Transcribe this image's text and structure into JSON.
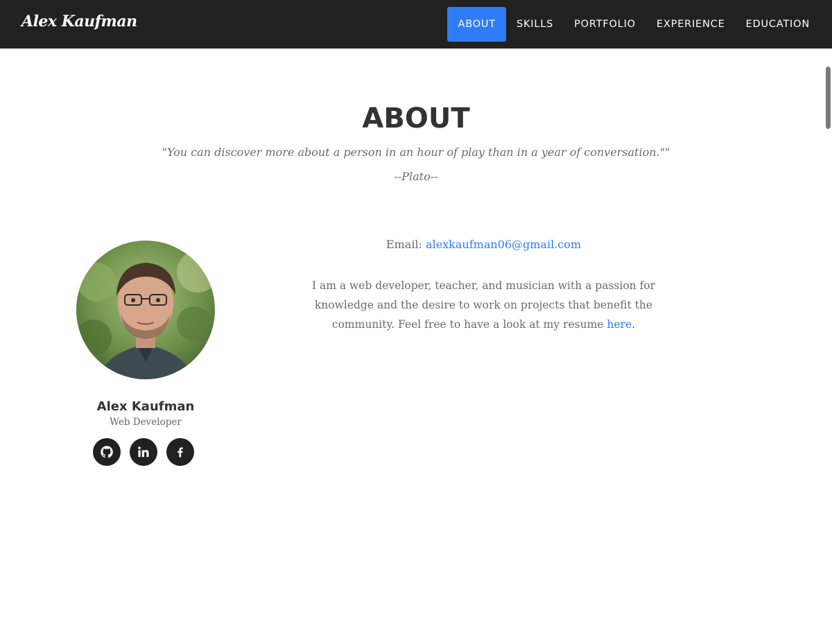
{
  "navbar": {
    "brand": "Alex Kaufman",
    "items": [
      {
        "label": "ABOUT",
        "active": true
      },
      {
        "label": "SKILLS",
        "active": false
      },
      {
        "label": "PORTFOLIO",
        "active": false
      },
      {
        "label": "EXPERIENCE",
        "active": false
      },
      {
        "label": "EDUCATION",
        "active": false
      }
    ]
  },
  "about": {
    "title": "ABOUT",
    "quote": "\"You can discover more about a person in an hour of play than in a year of conversation.\"\"",
    "quote_author": "--Plato--"
  },
  "profile": {
    "name": "Alex Kaufman",
    "role": "Web Developer",
    "socials": [
      "github-icon",
      "linkedin-icon",
      "facebook-icon"
    ]
  },
  "contact": {
    "email_label": "Email:",
    "email": "alexkaufman06@gmail.com"
  },
  "bio": {
    "text": "I am a web developer, teacher, and musician with a passion for knowledge and the desire to work on projects that benefit the community. Feel free to have a look at my resume",
    "link_text": "here",
    "suffix": "."
  },
  "colors": {
    "navbar_bg": "#212121",
    "accent": "#2f7cf6",
    "heading": "#333333",
    "body_text": "#6b6b6b"
  }
}
